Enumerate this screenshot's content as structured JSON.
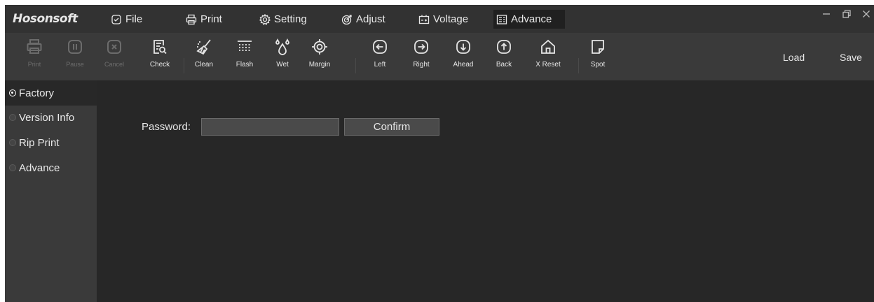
{
  "app": {
    "brand": "Hosonsoft"
  },
  "menu": [
    {
      "label": "File",
      "icon": "file-check-icon"
    },
    {
      "label": "Print",
      "icon": "printer-icon"
    },
    {
      "label": "Setting",
      "icon": "gear-icon"
    },
    {
      "label": "Adjust",
      "icon": "target-icon"
    },
    {
      "label": "Voltage",
      "icon": "battery-icon"
    },
    {
      "label": "Advance",
      "icon": "document-list-icon",
      "active": true
    }
  ],
  "window_controls": [
    "—",
    "❐",
    "✕"
  ],
  "toolbar": {
    "tools": [
      {
        "label": "Print",
        "icon": "printer-icon",
        "enabled": false
      },
      {
        "label": "Pause",
        "icon": "pause-icon",
        "enabled": false
      },
      {
        "label": "Cancel",
        "icon": "cancel-icon",
        "enabled": false
      },
      {
        "label": "Check",
        "icon": "check-doc-icon",
        "enabled": true
      },
      {
        "label": "Clean",
        "icon": "broom-icon",
        "enabled": true
      },
      {
        "label": "Flash",
        "icon": "flash-grid-icon",
        "enabled": true
      },
      {
        "label": "Wet",
        "icon": "droplet-icon",
        "enabled": true
      },
      {
        "label": "Margin",
        "icon": "crosshair-icon",
        "enabled": true
      },
      {
        "label": "Left",
        "icon": "arrow-left-icon",
        "enabled": true
      },
      {
        "label": "Right",
        "icon": "arrow-right-icon",
        "enabled": true
      },
      {
        "label": "Ahead",
        "icon": "arrow-down-icon",
        "enabled": true
      },
      {
        "label": "Back",
        "icon": "arrow-up-icon",
        "enabled": true
      },
      {
        "label": "X Reset",
        "icon": "home-icon",
        "enabled": true
      },
      {
        "label": "Spot",
        "icon": "page-fold-icon",
        "enabled": true
      }
    ],
    "load_label": "Load",
    "save_label": "Save"
  },
  "sidebar": {
    "items": [
      {
        "label": "Factory",
        "selected": true
      },
      {
        "label": "Version Info",
        "selected": false
      },
      {
        "label": "Rip Print",
        "selected": false
      },
      {
        "label": "Advance",
        "selected": false
      }
    ]
  },
  "content": {
    "password_label": "Password:",
    "password_value": "",
    "confirm_label": "Confirm"
  },
  "colors": {
    "background": "#272727",
    "toolbar": "#3a3a3a",
    "menubar": "#323232",
    "text": "#e6e6e6",
    "disabled_text": "#6c6c6c"
  }
}
